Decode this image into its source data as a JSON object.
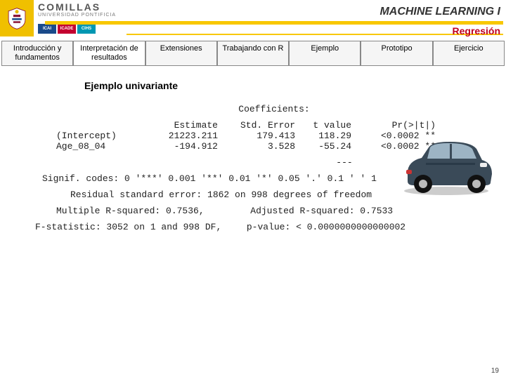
{
  "header": {
    "brand": "COMILLAS",
    "brand_sub": "UNIVERSIDAD PONTIFICIA",
    "badges": [
      "ICAI",
      "ICADE",
      "CIHS"
    ],
    "course": "MACHINE LEARNING I",
    "subtitle": "Regresión"
  },
  "tabs": [
    {
      "label": "Introducción y fundamentos",
      "active": false
    },
    {
      "label": "Interpretación de resultados",
      "active": true
    },
    {
      "label": "Extensiones",
      "active": false
    },
    {
      "label": "Trabajando con R",
      "active": false
    },
    {
      "label": "Ejemplo",
      "active": false
    },
    {
      "label": "Prototipo",
      "active": false
    },
    {
      "label": "Ejercicio",
      "active": false
    }
  ],
  "section_title": "Ejemplo univariante",
  "output": {
    "coef_header": "Coefficients:",
    "col_headers": {
      "est": "Estimate",
      "se": "Std. Error",
      "t": "t value",
      "p": "Pr(>|t|)"
    },
    "rows": [
      {
        "name": "(Intercept)",
        "est": "21223.211",
        "se": "179.413",
        "t": "118.29",
        "p": "<0.0002 **"
      },
      {
        "name": "Age_08_04",
        "est": "-194.912",
        "se": "3.528",
        "t": "-55.24",
        "p": "<0.0002 **"
      }
    ],
    "dashes": "---",
    "signif": "Signif. codes:  0 '***' 0.001 '**' 0.01 '*' 0.05 '.' 0.1 ' ' 1",
    "rse": "Residual standard error: 1862 on 998 degrees of freedom",
    "r2_a": "Multiple R-squared:  0.7536,",
    "r2_b": "Adjusted R-squared:  0.7533",
    "fstat_a": "F-statistic:  3052 on 1 and 998 DF,",
    "fstat_b": "p-value: < 0.0000000000000002"
  },
  "page_number": "19"
}
